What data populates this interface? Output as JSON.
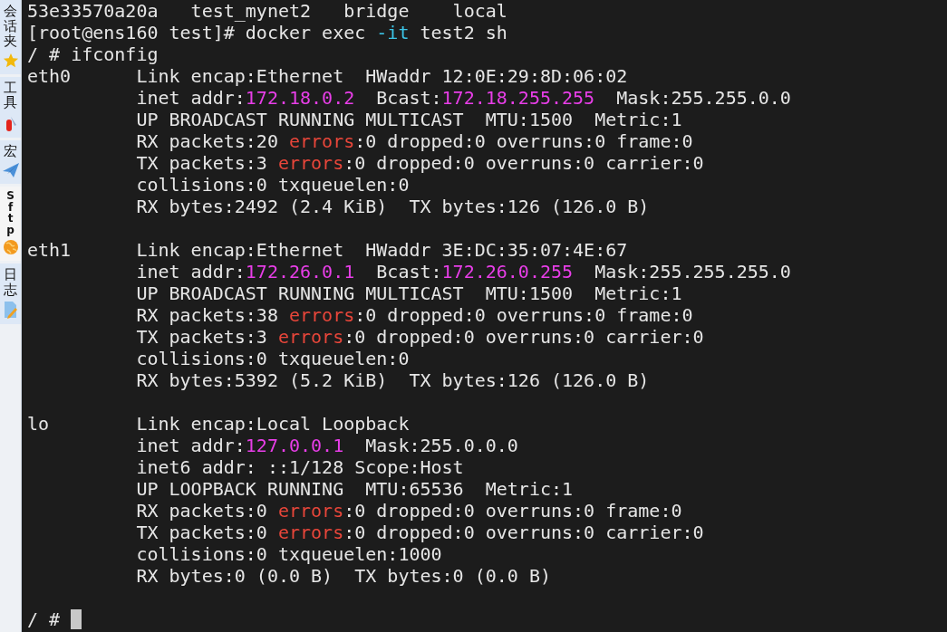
{
  "sidebar": {
    "tabs": [
      {
        "label": "会话夹",
        "selected": false
      },
      {
        "label": "工具",
        "selected": false
      },
      {
        "label": "宏",
        "selected": false
      },
      {
        "label": "Sftp",
        "selected": true
      },
      {
        "label": "日志",
        "selected": false
      }
    ]
  },
  "terminal": {
    "blocks": [
      [
        [
          {
            "text": "53e33570a20a   test_mynet2   bridge    local"
          }
        ],
        [
          {
            "text": "[root@ens160 test]# docker exec "
          },
          {
            "text": "-it",
            "color": "#3cc4e6"
          },
          {
            "text": " test2 sh"
          }
        ],
        [
          {
            "text": "/ # ifconfig"
          }
        ],
        [
          {
            "text": "eth0      Link encap:Ethernet  HWaddr 12:0E:29:8D:06:02"
          }
        ],
        [
          {
            "text": "          inet addr:"
          },
          {
            "text": "172.18.0.2",
            "color": "#e83ee8"
          },
          {
            "text": "  Bcast:"
          },
          {
            "text": "172.18.255.255",
            "color": "#e83ee8"
          },
          {
            "text": "  Mask:255.255.0.0"
          }
        ],
        [
          {
            "text": "          UP BROADCAST RUNNING MULTICAST  MTU:1500  Metric:1"
          }
        ],
        [
          {
            "text": "          RX packets:20 "
          },
          {
            "text": "errors",
            "color": "#e8463a"
          },
          {
            "text": ":0 dropped:0 overruns:0 frame:0"
          }
        ],
        [
          {
            "text": "          TX packets:3 "
          },
          {
            "text": "errors",
            "color": "#e8463a"
          },
          {
            "text": ":0 dropped:0 overruns:0 carrier:0"
          }
        ],
        [
          {
            "text": "          collisions:0 txqueuelen:0"
          }
        ],
        [
          {
            "text": "          RX bytes:2492 (2.4 KiB)  TX bytes:126 (126.0 B)"
          }
        ]
      ],
      [
        [
          {
            "text": "eth1      Link encap:Ethernet  HWaddr 3E:DC:35:07:4E:67"
          }
        ],
        [
          {
            "text": "          inet addr:"
          },
          {
            "text": "172.26.0.1",
            "color": "#e83ee8"
          },
          {
            "text": "  Bcast:"
          },
          {
            "text": "172.26.0.255",
            "color": "#e83ee8"
          },
          {
            "text": "  Mask:255.255.255.0"
          }
        ],
        [
          {
            "text": "          UP BROADCAST RUNNING MULTICAST  MTU:1500  Metric:1"
          }
        ],
        [
          {
            "text": "          RX packets:38 "
          },
          {
            "text": "errors",
            "color": "#e8463a"
          },
          {
            "text": ":0 dropped:0 overruns:0 frame:0"
          }
        ],
        [
          {
            "text": "          TX packets:3 "
          },
          {
            "text": "errors",
            "color": "#e8463a"
          },
          {
            "text": ":0 dropped:0 overruns:0 carrier:0"
          }
        ],
        [
          {
            "text": "          collisions:0 txqueuelen:0"
          }
        ],
        [
          {
            "text": "          RX bytes:5392 (5.2 KiB)  TX bytes:126 (126.0 B)"
          }
        ]
      ],
      [
        [
          {
            "text": "lo        Link encap:Local Loopback"
          }
        ],
        [
          {
            "text": "          inet addr:"
          },
          {
            "text": "127.0.0.1",
            "color": "#e83ee8"
          },
          {
            "text": "  Mask:255.0.0.0"
          }
        ],
        [
          {
            "text": "          inet6 addr: ::1/128 Scope:Host"
          }
        ],
        [
          {
            "text": "          UP LOOPBACK RUNNING  MTU:65536  Metric:1"
          }
        ],
        [
          {
            "text": "          RX packets:0 "
          },
          {
            "text": "errors",
            "color": "#e8463a"
          },
          {
            "text": ":0 dropped:0 overruns:0 frame:0"
          }
        ],
        [
          {
            "text": "          TX packets:0 "
          },
          {
            "text": "errors",
            "color": "#e8463a"
          },
          {
            "text": ":0 dropped:0 overruns:0 carrier:0"
          }
        ],
        [
          {
            "text": "          collisions:0 txqueuelen:1000"
          }
        ],
        [
          {
            "text": "          RX bytes:0 (0.0 B)  TX bytes:0 (0.0 B)"
          }
        ]
      ]
    ],
    "prompt": {
      "text": "/ #",
      "cursor": true
    }
  }
}
